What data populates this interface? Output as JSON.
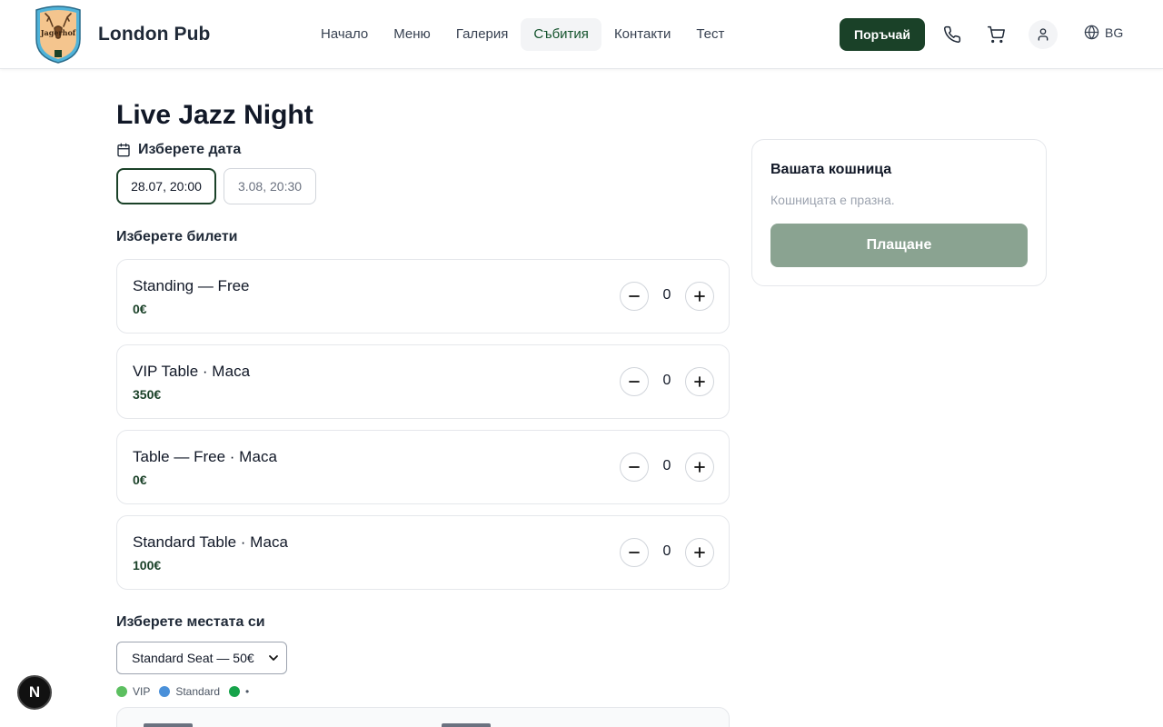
{
  "header": {
    "brand": "London Pub",
    "logo_text": "Jagerhof",
    "nav": [
      {
        "label": "Начало",
        "active": false
      },
      {
        "label": "Меню",
        "active": false
      },
      {
        "label": "Галерия",
        "active": false
      },
      {
        "label": "Събития",
        "active": true
      },
      {
        "label": "Контакти",
        "active": false
      },
      {
        "label": "Тест",
        "active": false
      }
    ],
    "order_label": "Поръчай",
    "language": "BG",
    "icons": [
      "phone-icon",
      "cart-icon",
      "user-icon",
      "globe-icon"
    ]
  },
  "event": {
    "title": "Live Jazz Night",
    "date_section_label": "Изберете дата",
    "dates": [
      {
        "label": "28.07, 20:00",
        "selected": true
      },
      {
        "label": "3.08, 20:30",
        "selected": false
      }
    ],
    "tickets_section_label": "Изберете билети",
    "tickets": [
      {
        "name": "Standing — Free",
        "price": "0€",
        "qty": "0"
      },
      {
        "name": "VIP Table · Маса",
        "price": "350€",
        "qty": "0"
      },
      {
        "name": "Table — Free · Маса",
        "price": "0€",
        "qty": "0"
      },
      {
        "name": "Standard Table · Маса",
        "price": "100€",
        "qty": "0"
      }
    ],
    "seats_section_label": "Изберете местата си",
    "seat_select_value": "Standard Seat — 50€",
    "legend": [
      {
        "label": "VIP",
        "color": "#5cbf60"
      },
      {
        "label": "Standard",
        "color": "#4a90d9"
      },
      {
        "label": "•",
        "color": "#16a34a"
      }
    ]
  },
  "cart": {
    "title": "Вашата кошница",
    "empty_text": "Кошницата е празна.",
    "pay_label": "Плащане"
  },
  "badge": {
    "label": "N"
  },
  "colors": {
    "primary": "#1a4128",
    "pay_disabled": "#8aa391",
    "price": "#1a4128"
  }
}
